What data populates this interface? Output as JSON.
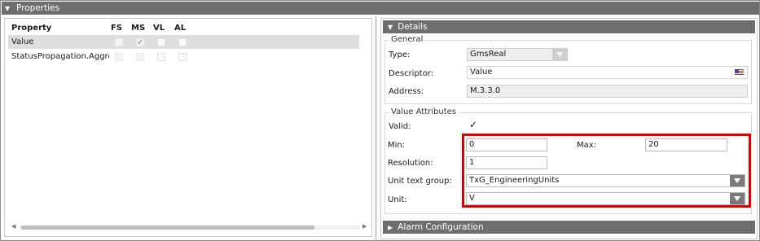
{
  "properties": {
    "title": "Properties",
    "columns": [
      "Property",
      "FS",
      "MS",
      "VL",
      "AL"
    ],
    "rows": [
      {
        "name": "Value",
        "selected": true,
        "fs": false,
        "ms": true,
        "vl": false,
        "al": false
      },
      {
        "name": "StatusPropagation.Aggregat",
        "selected": false,
        "fs": false,
        "ms": false,
        "vl": false,
        "al": false
      }
    ]
  },
  "details": {
    "title": "Details",
    "general": {
      "title": "General",
      "type_label": "Type:",
      "type_value": "GmsReal",
      "descriptor_label": "Descriptor:",
      "descriptor_value": "Value",
      "address_label": "Address:",
      "address_value": "M.3.3.0"
    },
    "value_attributes": {
      "title": "Value Attributes",
      "valid_label": "Valid:",
      "valid_checked": true,
      "min_label": "Min:",
      "min_value": "0",
      "max_label": "Max:",
      "max_value": "20",
      "resolution_label": "Resolution:",
      "resolution_value": "1",
      "unit_text_group_label": "Unit text group:",
      "unit_text_group_value": "TxG_EngineeringUnits",
      "unit_label": "Unit:",
      "unit_value": "V"
    }
  },
  "alarm_configuration": {
    "title": "Alarm Configuration"
  },
  "icons": {
    "collapse": "triangle-down",
    "expand": "triangle-right",
    "language": "us-flag-icon",
    "valid_check": "checkmark"
  },
  "colors": {
    "header_bg": "#6e6e6e",
    "highlight": "#e00000",
    "selected_row": "#dedede"
  }
}
